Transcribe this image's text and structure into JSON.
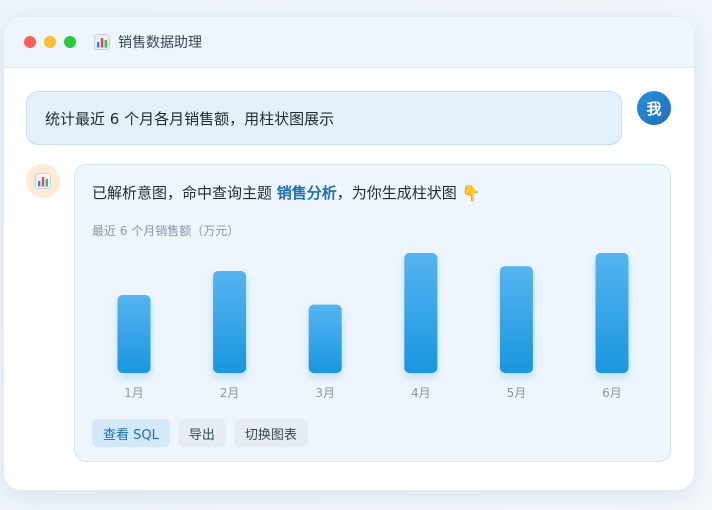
{
  "window": {
    "title": "销售数据助理",
    "app_icon": "bar-chart-icon"
  },
  "user_message": {
    "text": "统计最近 6 个月各月销售额，用柱状图展示",
    "avatar_label": "我"
  },
  "bot_message": {
    "text_before": "已解析意图，命中查询主题 ",
    "topic": "销售分析",
    "text_after": "，为你生成柱状图 ",
    "emoji": "👇",
    "avatar_icon": "bar-chart-icon"
  },
  "chart_data": {
    "type": "bar",
    "title": "最近 6 个月销售额（万元）",
    "categories": [
      "1月",
      "2月",
      "3月",
      "4月",
      "5月",
      "6月"
    ],
    "values": [
      65,
      85,
      57,
      100,
      89,
      100
    ],
    "xlabel": "",
    "ylabel": "",
    "ylim": [
      0,
      100
    ],
    "grid": false,
    "colors": {
      "bar_top": "#56b4ef",
      "bar_bottom": "#1996df",
      "tick_label": "#8a97a8"
    }
  },
  "actions": {
    "view_sql": "查看 SQL",
    "export": "导出",
    "switch_chart": "切换图表"
  },
  "colors": {
    "accent": "#1b6fb8",
    "user_bubble": "#e3f1fc",
    "bot_card": "#eef5fd"
  }
}
